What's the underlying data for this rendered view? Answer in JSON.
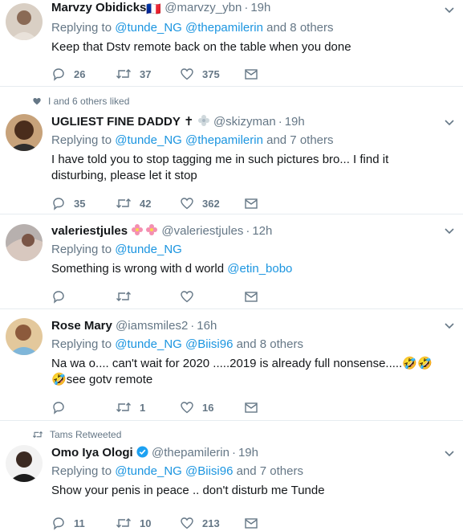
{
  "tweets": [
    {
      "name": "Marvzy Obidicks",
      "flag": "🇫🇷",
      "handle": "@marvzy_ybn",
      "time": "19h",
      "replying_prefix": "Replying to",
      "mentions": [
        "@tunde_NG",
        "@thepamilerin"
      ],
      "others": "and 8 others",
      "text": "Keep that Dstv remote back on the table when you done",
      "replies": "26",
      "retweets": "37",
      "likes": "375"
    },
    {
      "context": "I and 6 others liked",
      "name": "UGLIEST FINE DADDY",
      "name_suffix": "✝",
      "handle": "@skizyman",
      "time": "19h",
      "replying_prefix": "Replying to",
      "mentions": [
        "@tunde_NG",
        "@thepamilerin"
      ],
      "others": "and 7 others",
      "text": "I have told you to stop tagging me in such pictures bro... I find it disturbing, please let it stop",
      "replies": "35",
      "retweets": "42",
      "likes": "362"
    },
    {
      "name": "valeriestjules",
      "handle": "@valeriestjules",
      "time": "12h",
      "replying_prefix": "Replying to",
      "mentions": [
        "@tunde_NG"
      ],
      "others": "",
      "text": "Something is wrong with d world",
      "text_mention": "@etin_bobo",
      "replies": "",
      "retweets": "",
      "likes": ""
    },
    {
      "name": "Rose Mary",
      "handle": "@iamsmiles2",
      "time": "16h",
      "replying_prefix": "Replying to",
      "mentions": [
        "@tunde_NG",
        "@Biisi96"
      ],
      "others": "and 8 others",
      "text_before": "Na wa o.... can't wait for 2020 .....2019 is already full nonsense.....",
      "emoji": "🤣🤣🤣",
      "text_after": "see gotv remote",
      "replies": "",
      "retweets": "1",
      "likes": "16"
    },
    {
      "context": "Tams Retweeted",
      "name": "Omo Iya Ologi",
      "handle": "@thepamilerin",
      "time": "19h",
      "replying_prefix": "Replying to",
      "mentions": [
        "@tunde_NG",
        "@Biisi96"
      ],
      "others": "and 7 others",
      "text": "Show your penis in peace .. don't disturb me Tunde",
      "replies": "11",
      "retweets": "10",
      "likes": "213"
    }
  ],
  "colors": {
    "link": "#1b95e0",
    "muted": "#657786",
    "verified": "#1da1f2"
  }
}
